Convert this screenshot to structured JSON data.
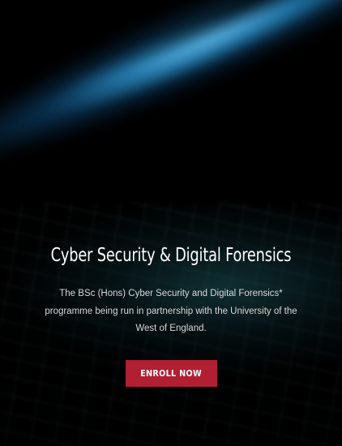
{
  "hero": {
    "title": "Cyber Security & Digital Forensics",
    "description": "The BSc (Hons) Cyber Security and Digital Forensics* programme being run in partnership with the University of the West of England.",
    "cta_label": "ENROLL NOW"
  },
  "colors": {
    "background": "#000000",
    "cta": "#b11f33",
    "title": "#ffffff",
    "text": "#d8d8d8"
  }
}
